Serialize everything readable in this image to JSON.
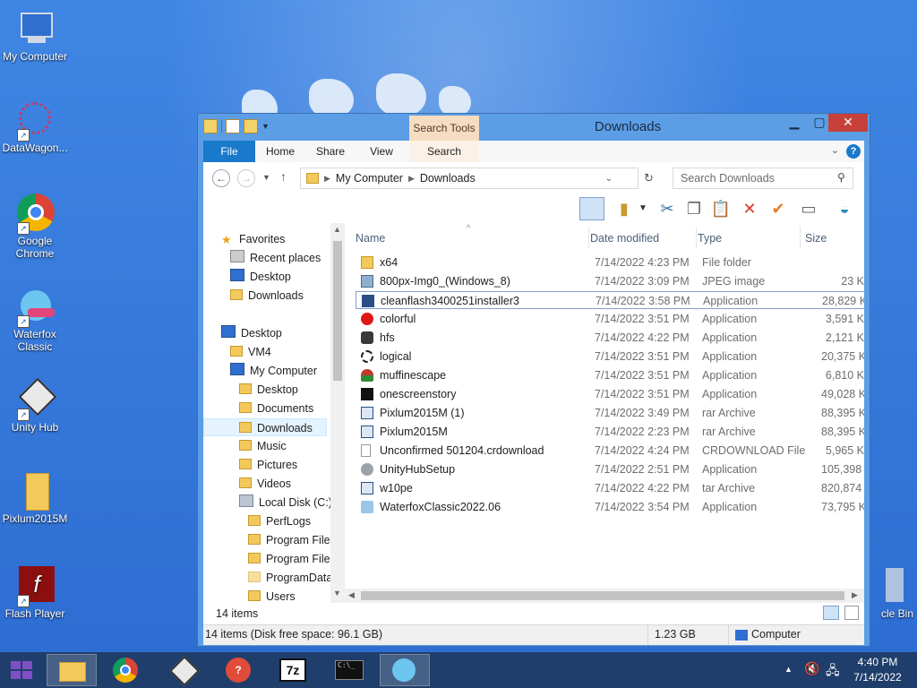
{
  "desktop": {
    "icons": [
      {
        "label": "My Computer"
      },
      {
        "label": "DataWagon..."
      },
      {
        "label": "Google Chrome"
      },
      {
        "label": "Waterfox Classic"
      },
      {
        "label": "Unity Hub"
      },
      {
        "label": "Pixlum2015M"
      },
      {
        "label": "Flash Player"
      },
      {
        "label": "cle Bin"
      }
    ]
  },
  "window": {
    "title": "Downloads",
    "contextual_tab": "Search Tools",
    "ribbon_tabs": [
      "File",
      "Home",
      "Share",
      "View",
      "Search"
    ],
    "address": {
      "segments": [
        "My Computer",
        "Downloads"
      ]
    },
    "search_placeholder": "Search Downloads",
    "nav": {
      "favorites": "Favorites",
      "recent": "Recent places",
      "desktop_fav": "Desktop",
      "downloads_fav": "Downloads",
      "desktop": "Desktop",
      "vm4": "VM4",
      "my_computer": "My Computer",
      "mc_items": [
        "Desktop",
        "Documents",
        "Downloads",
        "Music",
        "Pictures",
        "Videos"
      ],
      "local_disk": "Local Disk (C:)",
      "disk_items": [
        "PerfLogs",
        "Program Files",
        "Program Files",
        "ProgramData",
        "Users"
      ]
    },
    "columns": {
      "name": "Name",
      "date": "Date modified",
      "type": "Type",
      "size": "Size"
    },
    "files": [
      {
        "name": "x64",
        "date": "7/14/2022 4:23 PM",
        "type": "File folder",
        "size": ""
      },
      {
        "name": "800px-Img0_(Windows_8)",
        "date": "7/14/2022 3:09 PM",
        "type": "JPEG image",
        "size": "23 K"
      },
      {
        "name": "cleanflash3400251installer3",
        "date": "7/14/2022 3:58 PM",
        "type": "Application",
        "size": "28,829 K"
      },
      {
        "name": "colorful",
        "date": "7/14/2022 3:51 PM",
        "type": "Application",
        "size": "3,591 K"
      },
      {
        "name": "hfs",
        "date": "7/14/2022 4:22 PM",
        "type": "Application",
        "size": "2,121 K"
      },
      {
        "name": "logical",
        "date": "7/14/2022 3:51 PM",
        "type": "Application",
        "size": "20,375 K"
      },
      {
        "name": "muffinescape",
        "date": "7/14/2022 3:51 PM",
        "type": "Application",
        "size": "6,810 K"
      },
      {
        "name": "onescreenstory",
        "date": "7/14/2022 3:51 PM",
        "type": "Application",
        "size": "49,028 K"
      },
      {
        "name": "Pixlum2015M (1)",
        "date": "7/14/2022 3:49 PM",
        "type": "rar Archive",
        "size": "88,395 K"
      },
      {
        "name": "Pixlum2015M",
        "date": "7/14/2022 2:23 PM",
        "type": "rar Archive",
        "size": "88,395 K"
      },
      {
        "name": "Unconfirmed 501204.crdownload",
        "date": "7/14/2022 4:24 PM",
        "type": "CRDOWNLOAD File",
        "size": "5,965 K"
      },
      {
        "name": "UnityHubSetup",
        "date": "7/14/2022 2:51 PM",
        "type": "Application",
        "size": "105,398 K"
      },
      {
        "name": "w10pe",
        "date": "7/14/2022 4:22 PM",
        "type": "tar Archive",
        "size": "820,874 K"
      },
      {
        "name": "WaterfoxClassic2022.06",
        "date": "7/14/2022 3:54 PM",
        "type": "Application",
        "size": "73,795 K"
      }
    ],
    "item_count": "14 items",
    "status": {
      "left": "14 items (Disk free space: 96.1 GB)",
      "size": "1.23 GB",
      "location": "Computer"
    }
  },
  "taskbar": {
    "time": "4:40 PM",
    "date": "7/14/2022"
  }
}
